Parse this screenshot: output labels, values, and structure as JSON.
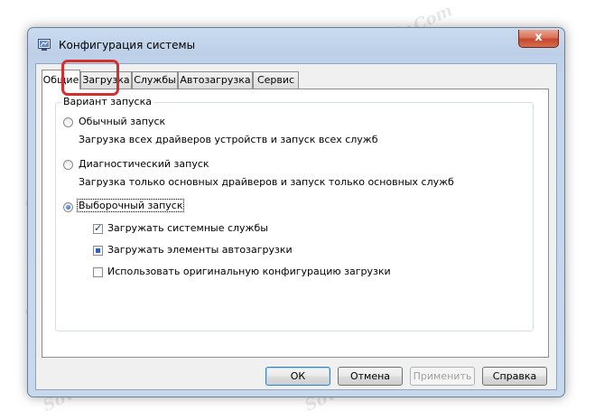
{
  "window": {
    "title": "Конфигурация системы",
    "close_label": "x"
  },
  "tabs": [
    {
      "label": "Общие",
      "active": true
    },
    {
      "label": "Загрузка",
      "active": false
    },
    {
      "label": "Службы",
      "active": false
    },
    {
      "label": "Автозагрузка",
      "active": false
    },
    {
      "label": "Сервис",
      "active": false
    }
  ],
  "startup": {
    "group_label": "Вариант запуска",
    "normal": {
      "label": "Обычный запуск",
      "description": "Загрузка всех драйверов устройств и запуск всех служб",
      "selected": false
    },
    "diagnostic": {
      "label": "Диагностический запуск",
      "description": "Загрузка только основных драйверов и запуск только основных служб",
      "selected": false
    },
    "selective": {
      "label": "Выборочный запуск",
      "selected": true,
      "options": [
        {
          "label": "Загружать системные службы",
          "state": "checked"
        },
        {
          "label": "Загружать элементы автозагрузки",
          "state": "indeterminate"
        },
        {
          "label": "Использовать оригинальную конфигурацию загрузки",
          "state": "unchecked"
        }
      ]
    }
  },
  "buttons": {
    "ok": "ОК",
    "cancel": "Отмена",
    "apply": "Применить",
    "help": "Справка"
  },
  "watermark": "Sovinaparsair.Com",
  "colors": {
    "highlight": "#d32f2f",
    "close_button": "#c6472d"
  }
}
